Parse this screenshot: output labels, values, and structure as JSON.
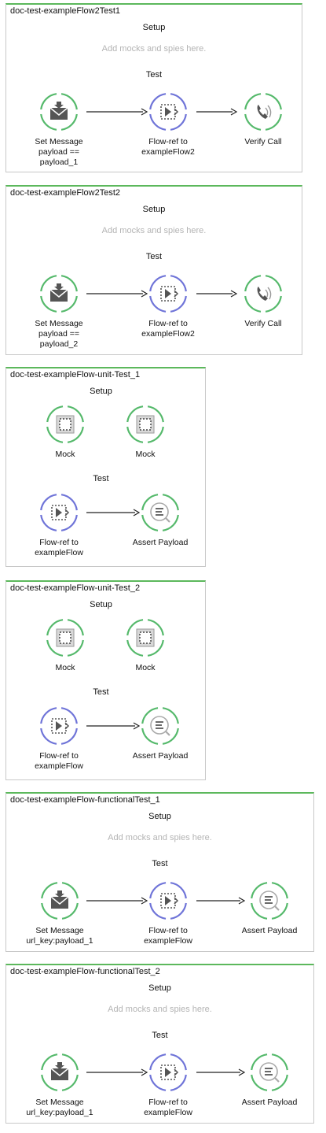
{
  "ui": {
    "placeholder_text": "Add mocks and spies here.",
    "accent_colors": {
      "processor": "#55b96b",
      "flow_ref": "#6f74d8",
      "suite_border": "#5cb85c"
    }
  },
  "suites": [
    {
      "title": "doc-test-exampleFlow2Test1",
      "setup_label": "Setup",
      "setup_placeholder": "Add mocks and spies here.",
      "test_label": "Test",
      "test_nodes": [
        {
          "icon": "envelope-icon",
          "ring": "green",
          "label": "Set Message\npayload ==\npayload_1"
        },
        {
          "icon": "flow-ref-icon",
          "ring": "blue",
          "label": "Flow-ref to\nexampleFlow2"
        },
        {
          "icon": "verify-call-icon",
          "ring": "green",
          "label": "Verify Call"
        }
      ]
    },
    {
      "title": "doc-test-exampleFlow2Test2",
      "setup_label": "Setup",
      "setup_placeholder": "Add mocks and spies here.",
      "test_label": "Test",
      "test_nodes": [
        {
          "icon": "envelope-icon",
          "ring": "green",
          "label": "Set Message\npayload ==\npayload_2"
        },
        {
          "icon": "flow-ref-icon",
          "ring": "blue",
          "label": "Flow-ref to\nexampleFlow2"
        },
        {
          "icon": "verify-call-icon",
          "ring": "green",
          "label": "Verify Call"
        }
      ]
    },
    {
      "title": "doc-test-exampleFlow-unit-Test_1",
      "setup_label": "Setup",
      "setup_nodes": [
        {
          "icon": "mock-icon",
          "ring": "green",
          "label": "Mock"
        },
        {
          "icon": "mock-icon",
          "ring": "green",
          "label": "Mock"
        }
      ],
      "test_label": "Test",
      "test_nodes": [
        {
          "icon": "flow-ref-icon",
          "ring": "blue",
          "label": "Flow-ref to\nexampleFlow"
        },
        {
          "icon": "assert-payload-icon",
          "ring": "green",
          "label": "Assert Payload"
        }
      ]
    },
    {
      "title": "doc-test-exampleFlow-unit-Test_2",
      "setup_label": "Setup",
      "setup_nodes": [
        {
          "icon": "mock-icon",
          "ring": "green",
          "label": "Mock"
        },
        {
          "icon": "mock-icon",
          "ring": "green",
          "label": "Mock"
        }
      ],
      "test_label": "Test",
      "test_nodes": [
        {
          "icon": "flow-ref-icon",
          "ring": "blue",
          "label": "Flow-ref to\nexampleFlow"
        },
        {
          "icon": "assert-payload-icon",
          "ring": "green",
          "label": "Assert Payload"
        }
      ]
    },
    {
      "title": "doc-test-exampleFlow-functionalTest_1",
      "setup_label": "Setup",
      "setup_placeholder": "Add mocks and spies here.",
      "test_label": "Test",
      "test_nodes": [
        {
          "icon": "envelope-icon",
          "ring": "green",
          "label": "Set Message\nurl_key:payload_1"
        },
        {
          "icon": "flow-ref-icon",
          "ring": "blue",
          "label": "Flow-ref to\nexampleFlow"
        },
        {
          "icon": "assert-payload-icon",
          "ring": "green",
          "label": "Assert Payload"
        }
      ]
    },
    {
      "title": "doc-test-exampleFlow-functionalTest_2",
      "setup_label": "Setup",
      "setup_placeholder": "Add mocks and spies here.",
      "test_label": "Test",
      "test_nodes": [
        {
          "icon": "envelope-icon",
          "ring": "green",
          "label": "Set Message\nurl_key:payload_1"
        },
        {
          "icon": "flow-ref-icon",
          "ring": "blue",
          "label": "Flow-ref to\nexampleFlow"
        },
        {
          "icon": "assert-payload-icon",
          "ring": "green",
          "label": "Assert Payload"
        }
      ]
    }
  ]
}
